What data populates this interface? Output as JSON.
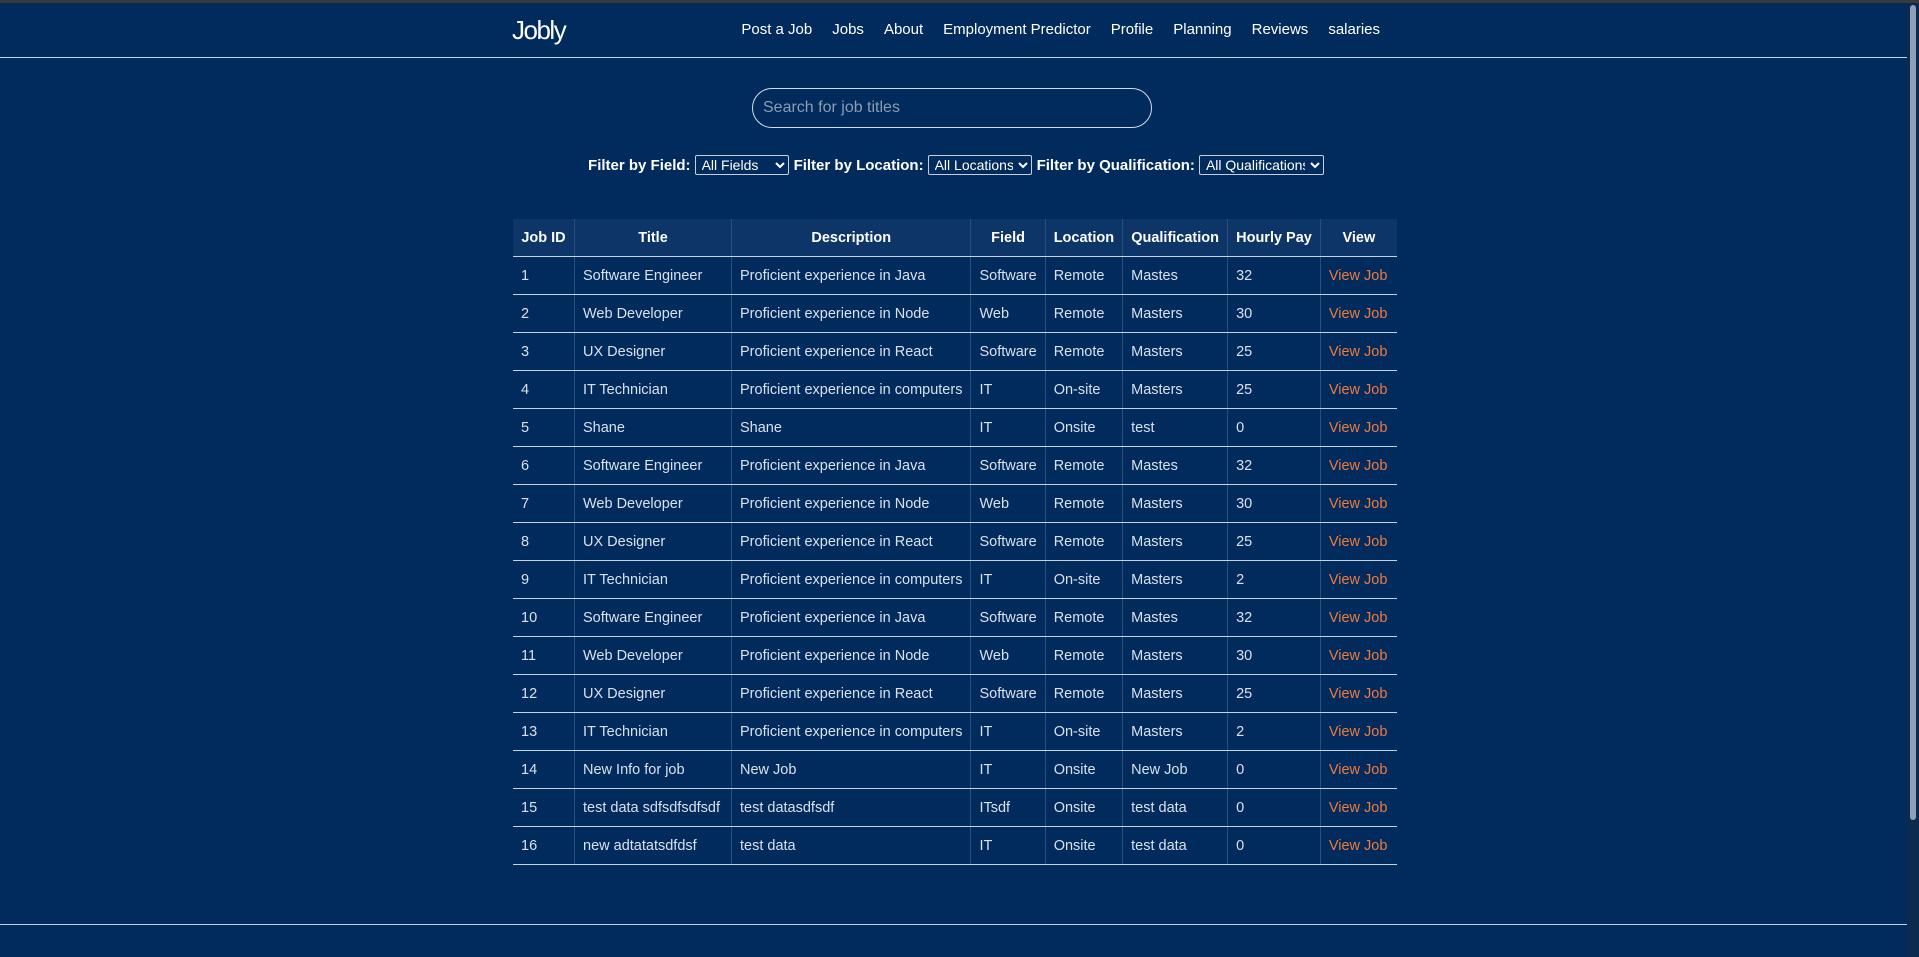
{
  "navbar": {
    "brand": "Jobly",
    "links": [
      "Post a Job",
      "Jobs",
      "About",
      "Employment Predictor",
      "Profile",
      "Planning",
      "Reviews",
      "salaries"
    ]
  },
  "search": {
    "placeholder": "Search for job titles",
    "value": ""
  },
  "filters": {
    "field_label": "Filter by Field:",
    "field_value": "All Fields",
    "location_label": "Filter by Location:",
    "location_value": "All Locations",
    "qualification_label": "Filter by Qualification:",
    "qualification_value": "All Qualifications"
  },
  "table": {
    "headers": [
      "Job ID",
      "Title",
      "Description",
      "Field",
      "Location",
      "Qualification",
      "Hourly Pay",
      "View"
    ],
    "rows": [
      {
        "id": "1",
        "title": "Software Engineer",
        "description": "Proficient experience in Java",
        "field": "Software",
        "location": "Remote",
        "qualification": "Mastes",
        "pay": "32",
        "view": "View Job"
      },
      {
        "id": "2",
        "title": "Web Developer",
        "description": "Proficient experience in Node",
        "field": "Web",
        "location": "Remote",
        "qualification": "Masters",
        "pay": "30",
        "view": "View Job"
      },
      {
        "id": "3",
        "title": "UX Designer",
        "description": "Proficient experience in React",
        "field": "Software",
        "location": "Remote",
        "qualification": "Masters",
        "pay": "25",
        "view": "View Job"
      },
      {
        "id": "4",
        "title": "IT Technician",
        "description": "Proficient experience in computers",
        "field": "IT",
        "location": "On-site",
        "qualification": "Masters",
        "pay": "25",
        "view": "View Job"
      },
      {
        "id": "5",
        "title": "Shane",
        "description": "Shane",
        "field": "IT",
        "location": "Onsite",
        "qualification": "test",
        "pay": "0",
        "view": "View Job"
      },
      {
        "id": "6",
        "title": "Software Engineer",
        "description": "Proficient experience in Java",
        "field": "Software",
        "location": "Remote",
        "qualification": "Mastes",
        "pay": "32",
        "view": "View Job"
      },
      {
        "id": "7",
        "title": "Web Developer",
        "description": "Proficient experience in Node",
        "field": "Web",
        "location": "Remote",
        "qualification": "Masters",
        "pay": "30",
        "view": "View Job"
      },
      {
        "id": "8",
        "title": "UX Designer",
        "description": "Proficient experience in React",
        "field": "Software",
        "location": "Remote",
        "qualification": "Masters",
        "pay": "25",
        "view": "View Job"
      },
      {
        "id": "9",
        "title": "IT Technician",
        "description": "Proficient experience in computers",
        "field": "IT",
        "location": "On-site",
        "qualification": "Masters",
        "pay": "2",
        "view": "View Job"
      },
      {
        "id": "10",
        "title": "Software Engineer",
        "description": "Proficient experience in Java",
        "field": "Software",
        "location": "Remote",
        "qualification": "Mastes",
        "pay": "32",
        "view": "View Job"
      },
      {
        "id": "11",
        "title": "Web Developer",
        "description": "Proficient experience in Node",
        "field": "Web",
        "location": "Remote",
        "qualification": "Masters",
        "pay": "30",
        "view": "View Job"
      },
      {
        "id": "12",
        "title": "UX Designer",
        "description": "Proficient experience in React",
        "field": "Software",
        "location": "Remote",
        "qualification": "Masters",
        "pay": "25",
        "view": "View Job"
      },
      {
        "id": "13",
        "title": "IT Technician",
        "description": "Proficient experience in computers",
        "field": "IT",
        "location": "On-site",
        "qualification": "Masters",
        "pay": "2",
        "view": "View Job"
      },
      {
        "id": "14",
        "title": "New Info for job",
        "description": "New Job",
        "field": "IT",
        "location": "Onsite",
        "qualification": "New Job",
        "pay": "0",
        "view": "View Job"
      },
      {
        "id": "15",
        "title": "test data sdfsdfsdfsdf",
        "description": "test datasdfsdf",
        "field": "ITsdf",
        "location": "Onsite",
        "qualification": "test data",
        "pay": "0",
        "view": "View Job"
      },
      {
        "id": "16",
        "title": "new adtatatsdfdsf",
        "description": "test data",
        "field": "IT",
        "location": "Onsite",
        "qualification": "test data",
        "pay": "0",
        "view": "View Job"
      }
    ]
  },
  "colors": {
    "background": "#002b5c",
    "header_background": "#0d3567",
    "link_accent": "#f07a3c",
    "text": "#ffffff",
    "cell_text": "#d9e1ec"
  }
}
